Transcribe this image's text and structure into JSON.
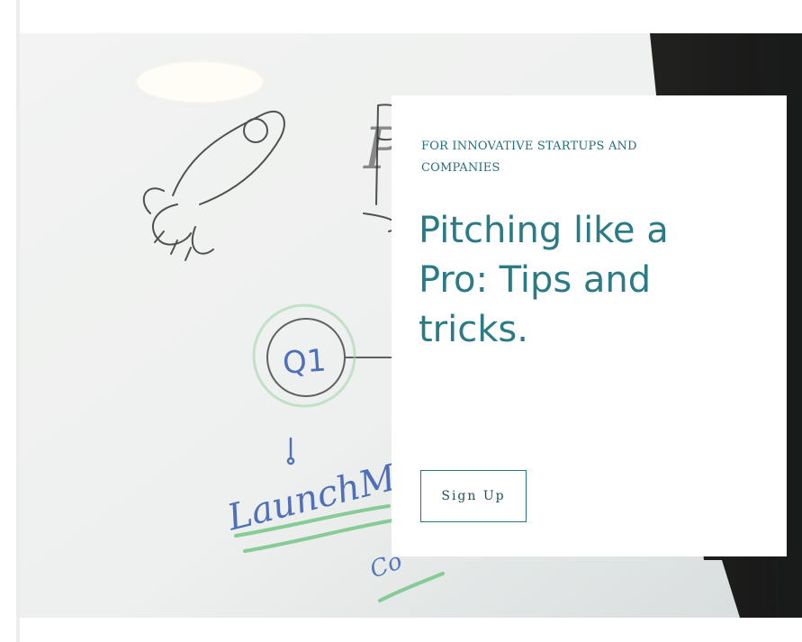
{
  "hero": {
    "eyebrow": "FOR INNOVATIVE STARTUPS AND COMPANIES",
    "headline": "Pitching like a Pro: Tips and tricks.",
    "cta_label": "Sign Up",
    "whiteboard_notes": {
      "heading_fragment": "Pr",
      "node_label": "Q1",
      "milestone": "LaunchMVP",
      "partial_note": "Co"
    }
  },
  "colors": {
    "accent": "#2a7b85",
    "eyebrow": "#236f7a",
    "button_border": "#2d7580",
    "button_text": "#1f4f56",
    "whiteboard_marker_blue": "#3f63b3",
    "whiteboard_marker_green": "#66c07a"
  },
  "icons": {
    "hero_image": "whiteboard-photo"
  }
}
